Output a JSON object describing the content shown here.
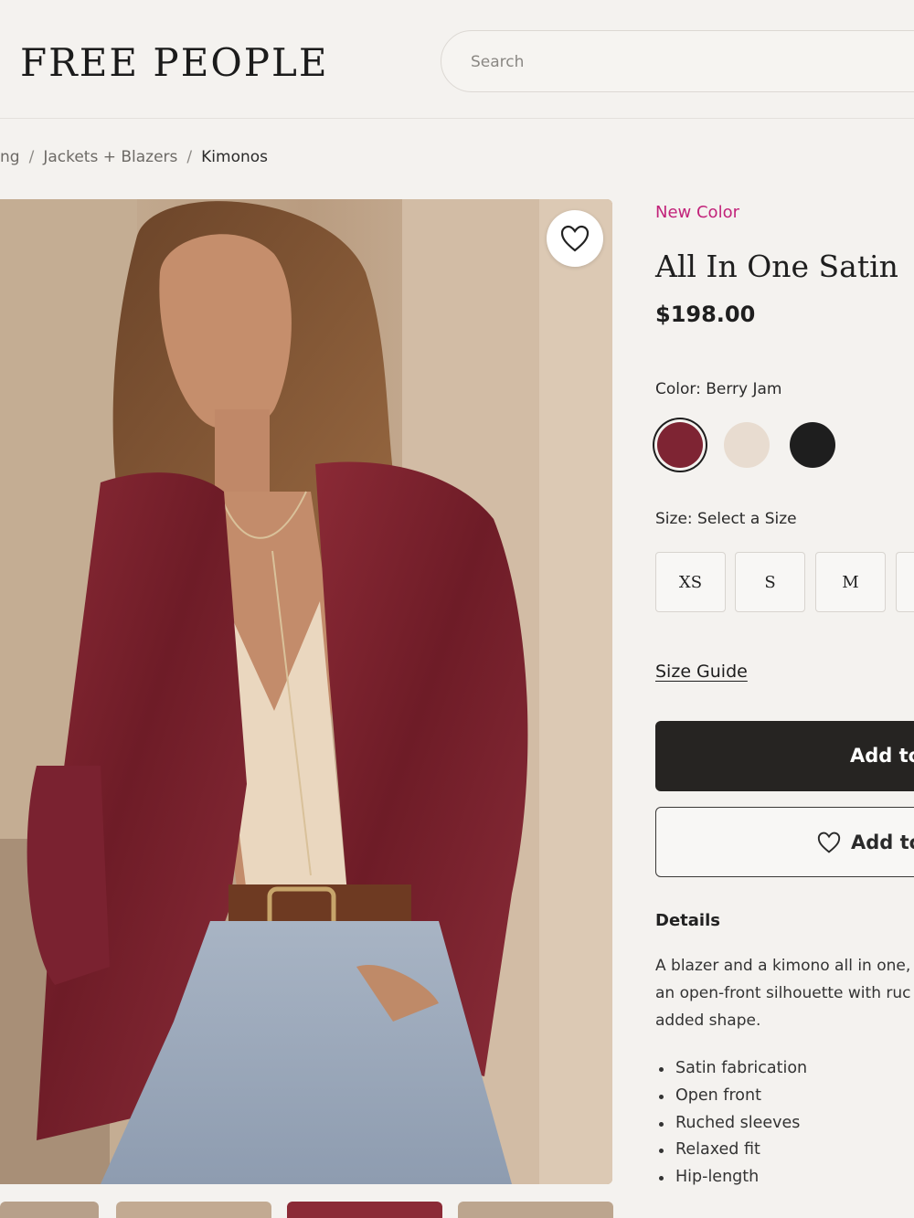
{
  "header": {
    "logo": "FREE PEOPLE",
    "search_placeholder": "Search"
  },
  "breadcrumb": {
    "items": [
      "ng",
      "Jackets + Blazers",
      "Kimonos"
    ],
    "separator": "/"
  },
  "product": {
    "badge": "New Color",
    "title": "All In One Satin",
    "price": "$198.00",
    "color_label": "Color: Berry Jam",
    "colors": [
      {
        "name": "Berry Jam",
        "hex": "#7e2433",
        "selected": true
      },
      {
        "name": "cream",
        "hex": "#e8dcd0",
        "selected": false
      },
      {
        "name": "black",
        "hex": "#1e1e1e",
        "selected": false
      }
    ],
    "size_label": "Size: Select a Size",
    "sizes": [
      "XS",
      "S",
      "M",
      ""
    ],
    "size_guide": "Size Guide",
    "add_to_bag": "Add to",
    "add_to_wishlist": "Add to",
    "details_heading": "Details",
    "description_lines": [
      "A blazer and a kimono all in one, t",
      "an open-front silhouette with ruc",
      "added shape."
    ],
    "bullets": [
      "Satin fabrication",
      "Open front",
      "Ruched sleeves",
      "Relaxed fit",
      "Hip-length"
    ]
  },
  "colors": {
    "accent_pink": "#c2237a",
    "button_dark": "#262422",
    "background": "#f4f2ef"
  },
  "icons": {
    "favorite": "heart-icon",
    "wishlist": "heart-outline-icon"
  }
}
